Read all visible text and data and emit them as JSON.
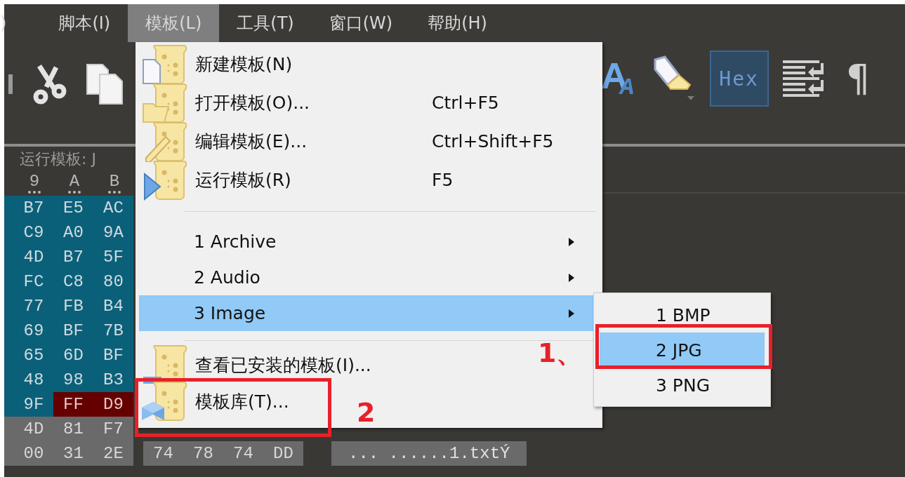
{
  "menubar": [
    {
      "label": ")",
      "selected": false
    },
    {
      "label": "脚本(I)",
      "selected": false
    },
    {
      "label": "模板(L)",
      "selected": true
    },
    {
      "label": "工具(T)",
      "selected": false
    },
    {
      "label": "窗口(W)",
      "selected": false
    },
    {
      "label": "帮助(H)",
      "selected": false
    }
  ],
  "toolbar": {
    "right": [
      {
        "kind": "font"
      },
      {
        "kind": "highlighter"
      },
      {
        "kind": "toggle",
        "label": "Hex",
        "on": true
      },
      {
        "kind": "wrap"
      },
      {
        "kind": "char",
        "label": "¶"
      }
    ]
  },
  "hex": {
    "template_label": "运行模板: J",
    "columns": [
      "9",
      "A",
      "B"
    ],
    "rows": [
      {
        "cells": [
          {
            "text": "B7",
            "kind": "selected"
          },
          {
            "text": "E5",
            "kind": "selected"
          },
          {
            "text": "AC",
            "kind": "selected"
          }
        ]
      },
      {
        "cells": [
          {
            "text": "C9",
            "kind": "selected"
          },
          {
            "text": "A0",
            "kind": "selected"
          },
          {
            "text": "9A",
            "kind": "selected"
          }
        ]
      },
      {
        "cells": [
          {
            "text": "4D",
            "kind": "selected"
          },
          {
            "text": "B7",
            "kind": "selected"
          },
          {
            "text": "5F",
            "kind": "selected"
          }
        ]
      },
      {
        "cells": [
          {
            "text": "FC",
            "kind": "selected"
          },
          {
            "text": "C8",
            "kind": "selected"
          },
          {
            "text": "80",
            "kind": "selected"
          }
        ]
      },
      {
        "cells": [
          {
            "text": "77",
            "kind": "selected"
          },
          {
            "text": "FB",
            "kind": "selected"
          },
          {
            "text": "B4",
            "kind": "selected"
          }
        ]
      },
      {
        "cells": [
          {
            "text": "69",
            "kind": "selected"
          },
          {
            "text": "BF",
            "kind": "selected"
          },
          {
            "text": "7B",
            "kind": "selected"
          }
        ]
      },
      {
        "cells": [
          {
            "text": "65",
            "kind": "selected"
          },
          {
            "text": "6D",
            "kind": "selected"
          },
          {
            "text": "BF",
            "kind": "selected"
          }
        ]
      },
      {
        "cells": [
          {
            "text": "48",
            "kind": "selected"
          },
          {
            "text": "98",
            "kind": "selected"
          },
          {
            "text": "B3",
            "kind": "selected"
          }
        ]
      },
      {
        "cells": [
          {
            "text": "9F",
            "kind": "selected"
          },
          {
            "text": "FF",
            "kind": "found"
          },
          {
            "text": "D9",
            "kind": "found"
          }
        ]
      },
      {
        "cells": [
          {
            "text": "4D",
            "kind": "plain"
          },
          {
            "text": "81",
            "kind": "plain"
          },
          {
            "text": "F7",
            "kind": "plain"
          }
        ]
      },
      {
        "cells": [
          {
            "text": "00",
            "kind": "plain"
          },
          {
            "text": "31",
            "kind": "plain"
          },
          {
            "text": "2E",
            "kind": "plain"
          },
          {
            "text": "74",
            "kind": "plain"
          },
          {
            "text": "78",
            "kind": "plain"
          },
          {
            "text": "74",
            "kind": "plain"
          },
          {
            "text": "DD",
            "kind": "plain"
          }
        ],
        "ascii": "... ......1.txtÝ"
      }
    ]
  },
  "menu": {
    "items": [
      {
        "kind": "command",
        "label": "新建模板(N)",
        "selected": false
      },
      {
        "kind": "command",
        "label": "打开模板(O)...",
        "shortcut": "Ctrl+F5",
        "selected": false
      },
      {
        "kind": "command",
        "label": "编辑模板(E)...",
        "shortcut": "Ctrl+Shift+F5",
        "selected": false
      },
      {
        "kind": "command",
        "label": "运行模板(R)",
        "shortcut": "F5",
        "selected": false
      },
      {
        "kind": "separator"
      },
      {
        "kind": "submenu",
        "label": "1 Archive",
        "selected": false
      },
      {
        "kind": "submenu",
        "label": "2 Audio",
        "selected": false
      },
      {
        "kind": "submenu",
        "label": "3 Image",
        "selected": true
      },
      {
        "kind": "separator"
      },
      {
        "kind": "command",
        "label": "查看已安装的模板(I)...",
        "selected": false
      },
      {
        "kind": "command",
        "label": "模板库(T)...",
        "selected": false
      }
    ]
  },
  "submenu": {
    "items": [
      {
        "label": "1 BMP",
        "selected": false
      },
      {
        "label": "2 JPG",
        "selected": true
      },
      {
        "label": "3 PNG",
        "selected": false
      }
    ]
  },
  "annotations": [
    "1、",
    "2"
  ]
}
